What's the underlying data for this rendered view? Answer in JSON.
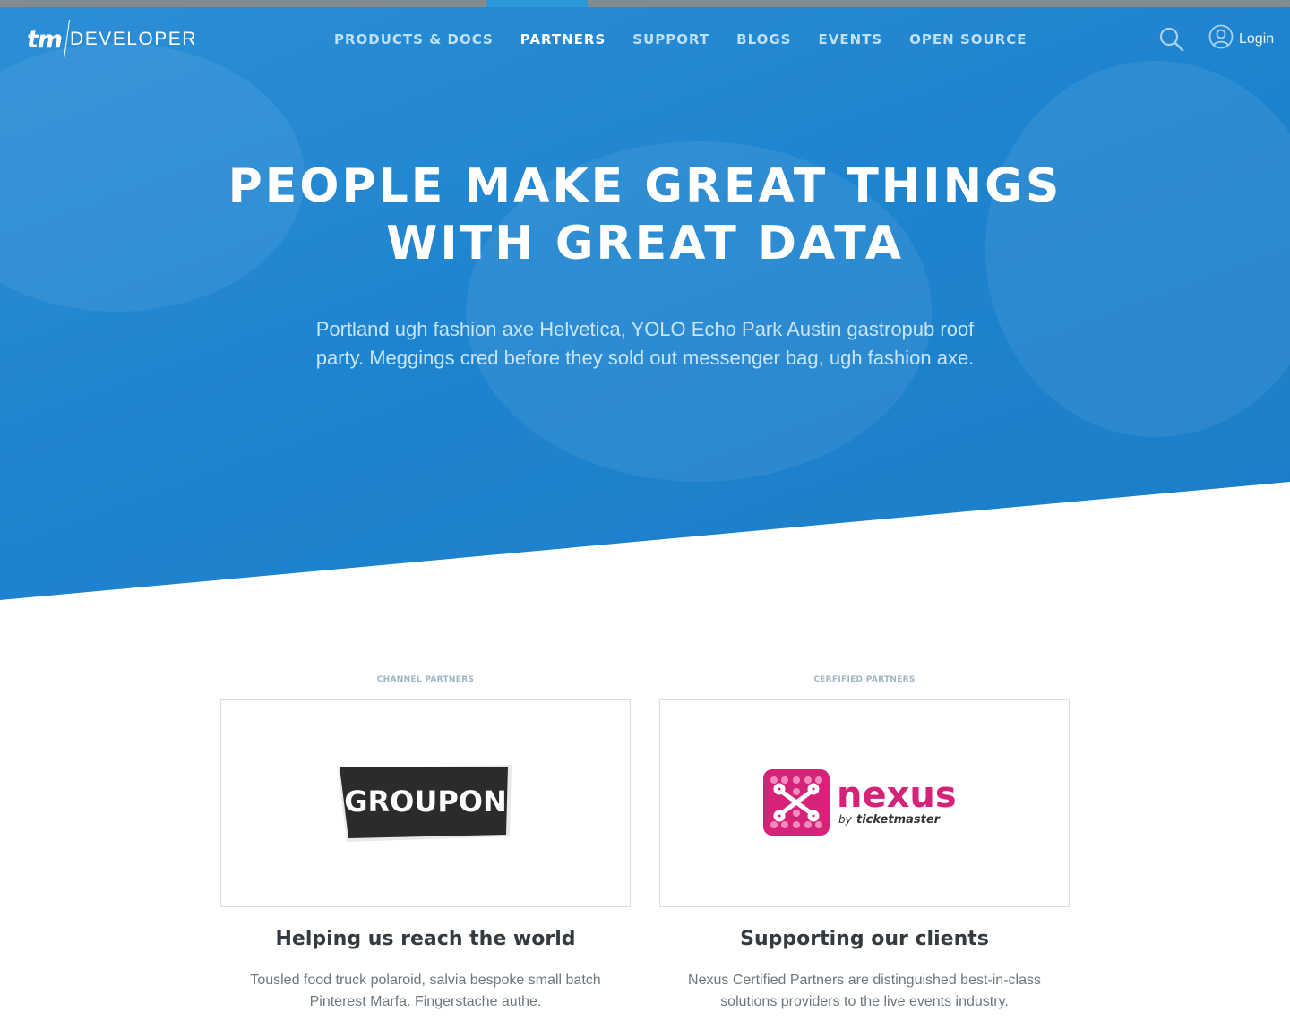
{
  "header": {
    "logo_mark": "tm",
    "logo_text": "DEVELOPER",
    "nav": [
      {
        "label": "PRODUCTS & DOCS",
        "active": false
      },
      {
        "label": "PARTNERS",
        "active": true
      },
      {
        "label": "SUPPORT",
        "active": false
      },
      {
        "label": "BLOGS",
        "active": false
      },
      {
        "label": "EVENTS",
        "active": false
      },
      {
        "label": "OPEN SOURCE",
        "active": false
      }
    ],
    "search_icon": "search-icon",
    "login_icon": "user-icon",
    "login_label": "Login"
  },
  "hero": {
    "title_line1": "PEOPLE MAKE GREAT THINGS",
    "title_line2": "WITH GREAT DATA",
    "subtitle": "Portland ugh fashion axe Helvetica, YOLO Echo Park Austin gastropub roof party. Meggings cred before they sold out messenger bag, ugh fashion axe."
  },
  "partners": [
    {
      "section_label": "CHANNEL PARTNERS",
      "logo_text": "GROUPON",
      "title": "Helping us reach the world",
      "description": "Tousled food truck polaroid, salvia bespoke small batch Pinterest Marfa. Fingerstache authe."
    },
    {
      "section_label": "CERFIFIED PARTNERS",
      "logo_text": "nexus",
      "logo_subtext_by": "by",
      "logo_subtext_brand": "ticketmaster",
      "title": "Supporting our clients",
      "description": "Nexus Certified Partners are distinguished best-in-class solutions providers to the live events industry."
    }
  ],
  "colors": {
    "hero_blue": "#1f84cf",
    "nav_inactive": "#bfe0f5",
    "top_bar": "#858a8e",
    "active_indicator": "#2a98d9",
    "nexus_pink": "#d6237a",
    "groupon_dark": "#2b2b2b"
  }
}
